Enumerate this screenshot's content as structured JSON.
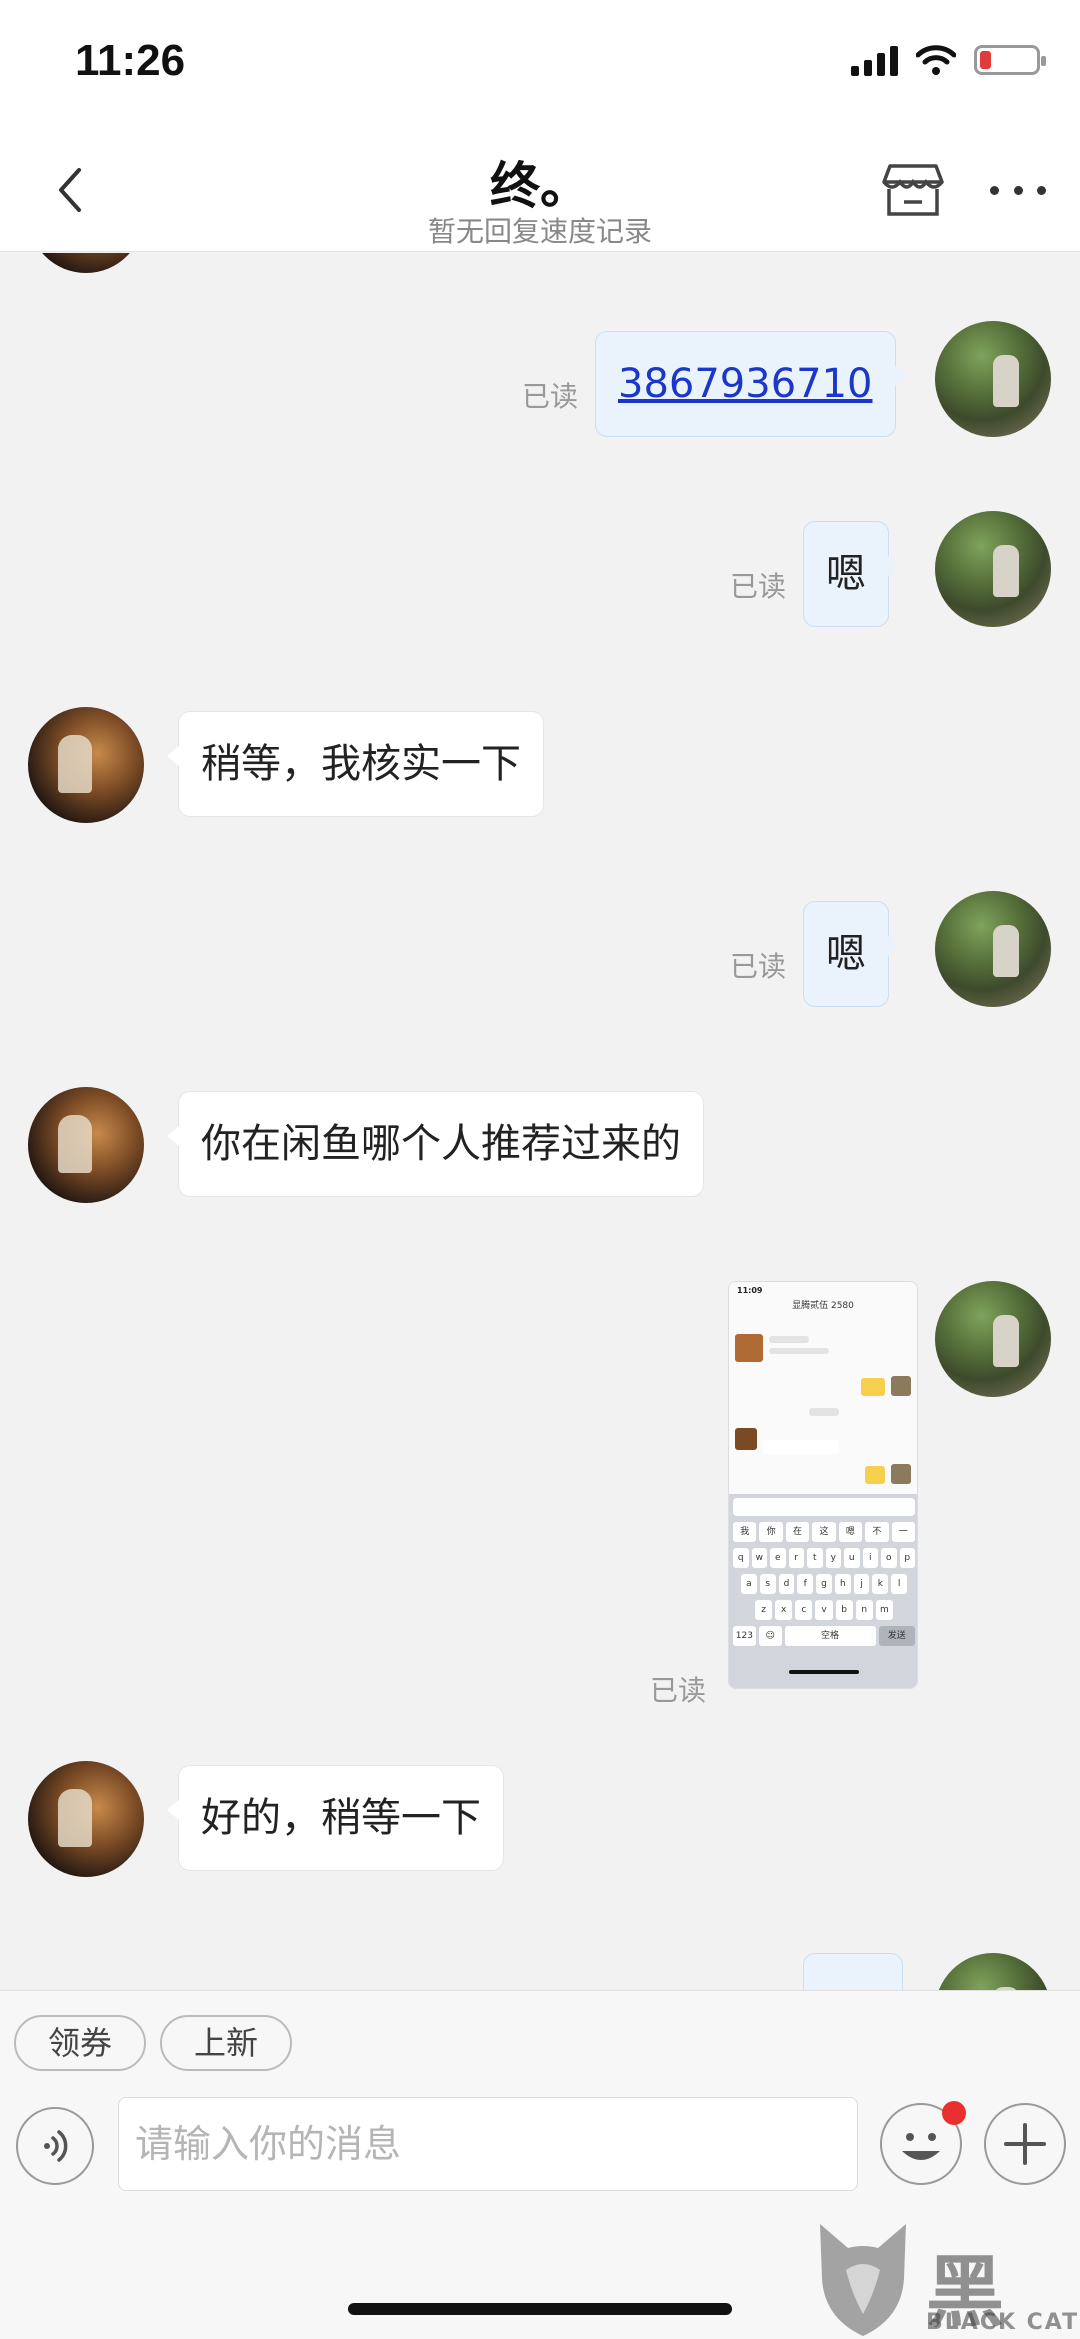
{
  "status_bar": {
    "time": "11:26"
  },
  "nav": {
    "title": "终。",
    "subtitle": "暂无回复速度记录"
  },
  "messages": [
    {
      "sender": "me",
      "text": "3867936710",
      "is_link": true,
      "status": "已读"
    },
    {
      "sender": "me",
      "text": "嗯",
      "status": "已读"
    },
    {
      "sender": "them",
      "text": "稍等，我核实一下"
    },
    {
      "sender": "me",
      "text": "嗯",
      "status": "已读"
    },
    {
      "sender": "them",
      "text": "你在闲鱼哪个人推荐过来的"
    },
    {
      "sender": "me",
      "type": "image",
      "status": "已读"
    },
    {
      "sender": "them",
      "text": "好的，稍等一下"
    }
  ],
  "screenshot_thumb": {
    "time": "11:09",
    "title": "显腾贰伍 2580",
    "keyboard_rows": [
      [
        "我",
        "你",
        "在",
        "这",
        "嗯",
        "不",
        "一"
      ],
      [
        "q",
        "w",
        "e",
        "r",
        "t",
        "y",
        "u",
        "i",
        "o",
        "p"
      ],
      [
        "a",
        "s",
        "d",
        "f",
        "g",
        "h",
        "j",
        "k",
        "l"
      ],
      [
        "z",
        "x",
        "c",
        "v",
        "b",
        "n",
        "m"
      ],
      [
        "123",
        "☺",
        "空格",
        "发送"
      ]
    ]
  },
  "quick_actions": [
    "领券",
    "上新"
  ],
  "input": {
    "placeholder": "请输入你的消息"
  },
  "watermark": {
    "text": "黑猫",
    "sub": "BLACK CAT"
  }
}
